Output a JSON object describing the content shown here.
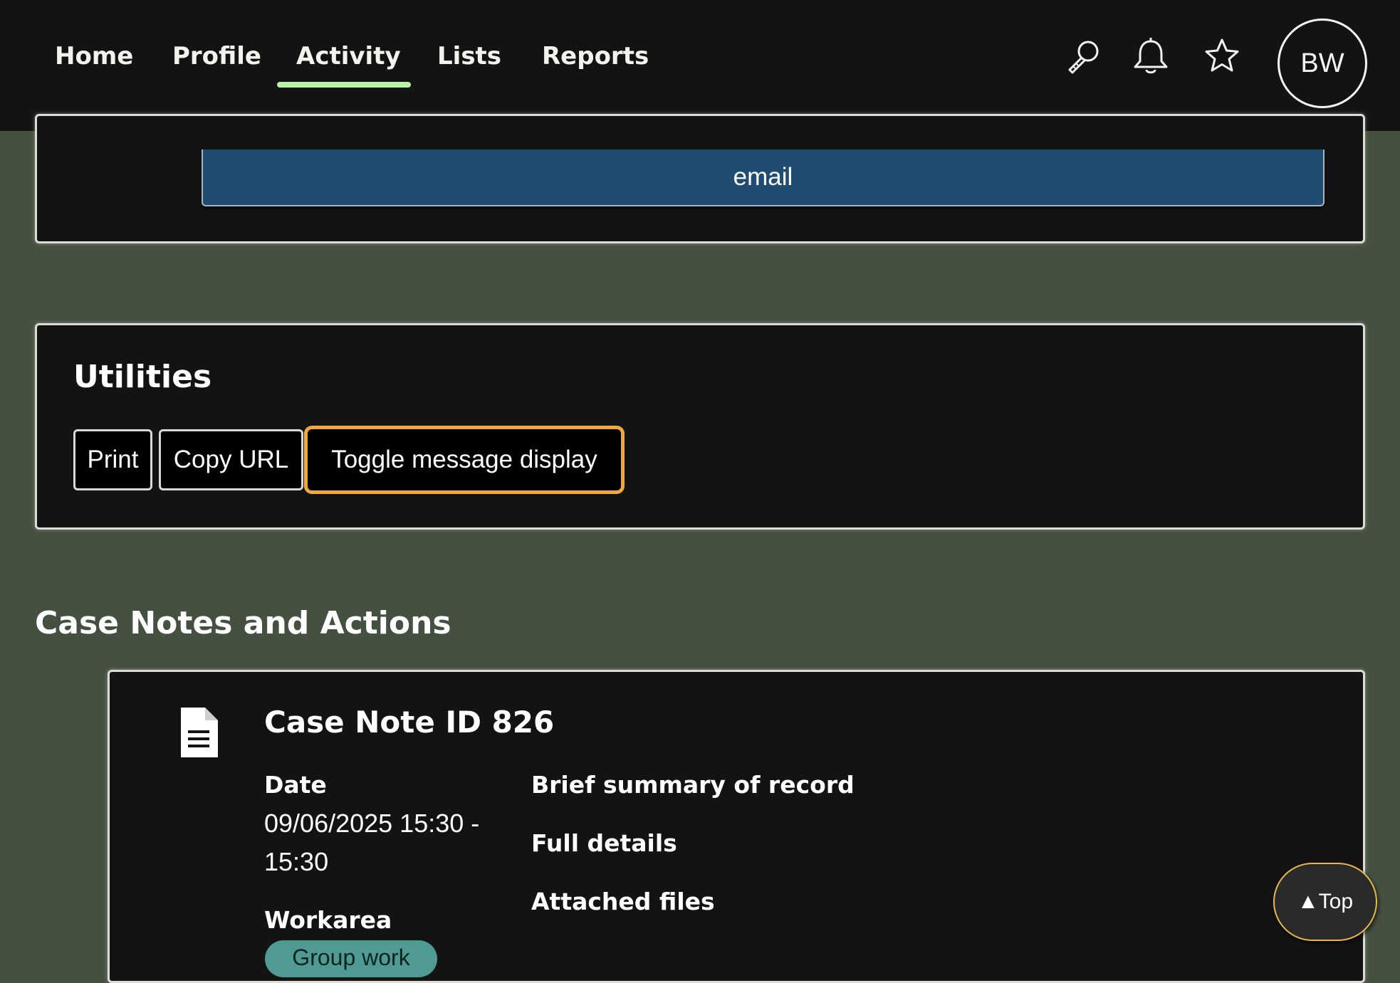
{
  "nav": {
    "items": [
      {
        "label": "Home"
      },
      {
        "label": "Profile"
      },
      {
        "label": "Activity",
        "active": true
      },
      {
        "label": "Lists"
      },
      {
        "label": "Reports"
      }
    ],
    "icons": [
      "search-icon",
      "bell-icon",
      "star-icon"
    ],
    "avatar_initials": "BW",
    "active_color": "#b9f3a6"
  },
  "contact_panel": {
    "email_button_label": "email"
  },
  "utilities": {
    "title": "Utilities",
    "buttons": {
      "print": "Print",
      "copy_url": "Copy URL",
      "toggle_message": "Toggle message display"
    },
    "focus_color": "#f2a93b"
  },
  "case_notes": {
    "heading": "Case Notes and Actions",
    "note": {
      "title": "Case Note ID 826",
      "icon": "document-icon",
      "date_label": "Date",
      "date_value": "09/06/2025 15:30 - 15:30",
      "workarea_label": "Workarea",
      "workarea_tag": "Group work",
      "summary_label": "Brief summary of record",
      "details_label": "Full details",
      "files_label": "Attached files"
    }
  },
  "back_to_top": {
    "label": "▲Top"
  }
}
